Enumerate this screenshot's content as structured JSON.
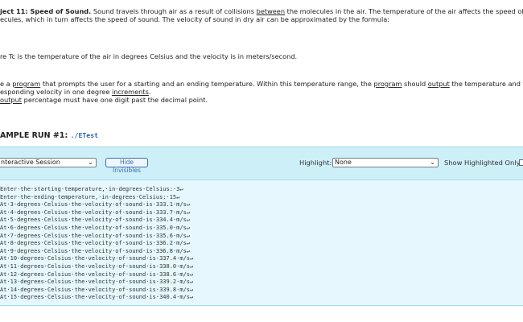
{
  "prompt": {
    "p1_title": "ject 11: Speed of Sound.",
    "p1_a": " Sound travels through air as a result of collisions ",
    "p1_u1": "between",
    "p1_b": " the molecules in the air. The temperature of the air affects the speed of the",
    "p1_line2": "ecules, which in turn affects the speed of sound. The velocity of sound in dry air can be approximated by the formula:",
    "p2": "re Tc is the temperature of the air in degrees Celsius and the velocity is in meters/second.",
    "p3_a": "e a ",
    "p3_u1": "program",
    "p3_b": " that prompts the user for a starting and an ending temperature. Within this temperature range, the ",
    "p3_u2": "program",
    "p3_c": " should ",
    "p3_u3": "output",
    "p3_d": " the temperature and the",
    "p3_line2a": "esponding velocity in one degree ",
    "p3_u4": "increments",
    "p3_line2b": ".",
    "p3_line3u": "output",
    "p3_line3b": " percentage must have one digit past the decimal point."
  },
  "sample": {
    "heading": "AMPLE RUN #1: ",
    "command": "./ETest"
  },
  "toolbar": {
    "session_select": "nteractive Session",
    "hide_button": "Hide Invisibles",
    "highlight_label": "Highlight:",
    "highlight_value": "None",
    "show_label": "Show Highlighted Only"
  },
  "session_lines": [
    "Enter·the·starting·temperature,·in·degrees·Celsius:·3↵",
    "Enter·the·ending·temperature,·in·degrees·Celsius:·15↵",
    "At·3·degrees·Celsius·the·velocity·of·sound·is·333.1·m/s↵",
    "At·4·degrees·Celsius·the·velocity·of·sound·is·333.7·m/s↵",
    "At·5·degrees·Celsius·the·velocity·of·sound·is·334.4·m/s↵",
    "At·6·degrees·Celsius·the·velocity·of·sound·is·335.0·m/s↵",
    "At·7·degrees·Celsius·the·velocity·of·sound·is·335.6·m/s↵",
    "At·8·degrees·Celsius·the·velocity·of·sound·is·336.2·m/s↵",
    "At·9·degrees·Celsius·the·velocity·of·sound·is·336.8·m/s↵",
    "At·10·degrees·Celsius·the·velocity·of·sound·is·337.4·m/s↵",
    "At·11·degrees·Celsius·the·velocity·of·sound·is·338.0·m/s↵",
    "At·12·degrees·Celsius·the·velocity·of·sound·is·338.6·m/s↵",
    "At·13·degrees·Celsius·the·velocity·of·sound·is·339.2·m/s↵",
    "At·14·degrees·Celsius·the·velocity·of·sound·is·339.8·m/s↵",
    "At·15·degrees·Celsius·the·velocity·of·sound·is·340.4·m/s↵"
  ],
  "colors": {
    "panel_bg": "#dff5fb",
    "toolbar_bg": "#cdf0f8",
    "command_blue": "#2a62b8",
    "button_blue": "#3f6da8"
  }
}
